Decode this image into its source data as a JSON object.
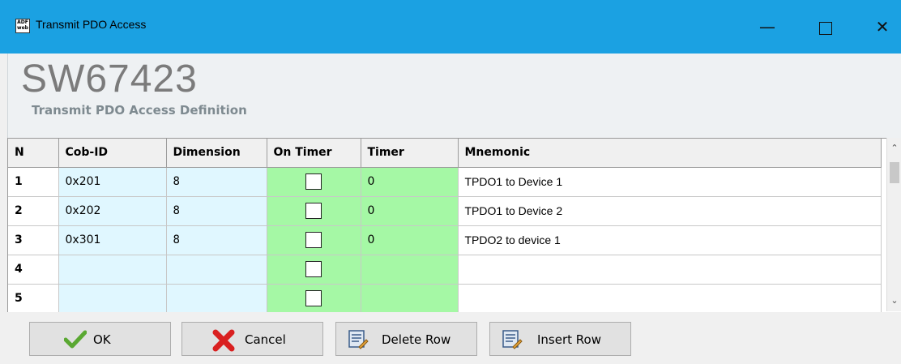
{
  "window": {
    "title": "Transmit PDO Access",
    "app_icon_text": "ADF\nweb"
  },
  "header": {
    "brand": "SW67423",
    "subtitle": "Transmit PDO Access Definition"
  },
  "table": {
    "columns": [
      "N",
      "Cob-ID",
      "Dimension",
      "On Timer",
      "Timer",
      "Mnemonic"
    ],
    "rows": [
      {
        "n": "1",
        "cob_id": "0x201",
        "dimension": "8",
        "on_timer": false,
        "timer": "0",
        "mnemonic": "TPDO1 to Device 1"
      },
      {
        "n": "2",
        "cob_id": "0x202",
        "dimension": "8",
        "on_timer": false,
        "timer": "0",
        "mnemonic": "TPDO1 to Device 2"
      },
      {
        "n": "3",
        "cob_id": "0x301",
        "dimension": "8",
        "on_timer": false,
        "timer": "0",
        "mnemonic": "TPDO2 to device 1"
      },
      {
        "n": "4",
        "cob_id": "",
        "dimension": "",
        "on_timer": false,
        "timer": "",
        "mnemonic": ""
      },
      {
        "n": "5",
        "cob_id": "",
        "dimension": "",
        "on_timer": false,
        "timer": "",
        "mnemonic": ""
      }
    ]
  },
  "buttons": {
    "ok": "OK",
    "cancel": "Cancel",
    "delete_row": "Delete Row",
    "insert_row": "Insert Row"
  },
  "colors": {
    "titlebar": "#1ba1e2",
    "cell_blue": "#e0f7ff",
    "cell_green": "#a5f8a5"
  }
}
